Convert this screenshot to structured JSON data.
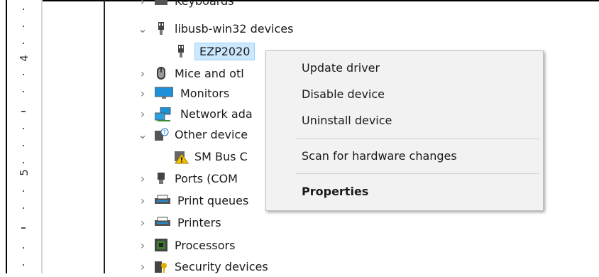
{
  "ruler": {
    "numbers": [
      "4",
      "5"
    ]
  },
  "tree": {
    "items": [
      {
        "label": "Keyboards",
        "chevron": "collapsed",
        "icon": "keyboard-icon"
      },
      {
        "label": "libusb-win32 devices",
        "chevron": "expanded",
        "icon": "usb-plug-icon"
      },
      {
        "label": "EZP2020",
        "chevron": "none",
        "icon": "usb-plug-icon",
        "selected": true
      },
      {
        "label": "Mice and otl",
        "chevron": "collapsed",
        "icon": "mouse-icon"
      },
      {
        "label": "Monitors",
        "chevron": "collapsed",
        "icon": "monitor-icon"
      },
      {
        "label": "Network ada",
        "chevron": "collapsed",
        "icon": "network-icon"
      },
      {
        "label": "Other device",
        "chevron": "expanded",
        "icon": "other-device-icon"
      },
      {
        "label": "SM Bus C",
        "chevron": "none",
        "icon": "warning-device-icon"
      },
      {
        "label": "Ports (COM",
        "chevron": "collapsed",
        "icon": "port-icon"
      },
      {
        "label": "Print queues",
        "chevron": "collapsed",
        "icon": "printer-icon"
      },
      {
        "label": "Printers",
        "chevron": "collapsed",
        "icon": "printer-icon"
      },
      {
        "label": "Processors",
        "chevron": "collapsed",
        "icon": "processor-icon"
      },
      {
        "label": "Security devices",
        "chevron": "collapsed",
        "icon": "security-device-icon"
      }
    ]
  },
  "context_menu": {
    "update_driver": "Update driver",
    "disable_device": "Disable device",
    "uninstall_device": "Uninstall device",
    "scan_hardware": "Scan for hardware changes",
    "properties": "Properties"
  },
  "colors": {
    "selection_bg": "#cce8ff",
    "menu_bg": "#f2f2f2",
    "monitor_blue": "#1e90d8"
  }
}
